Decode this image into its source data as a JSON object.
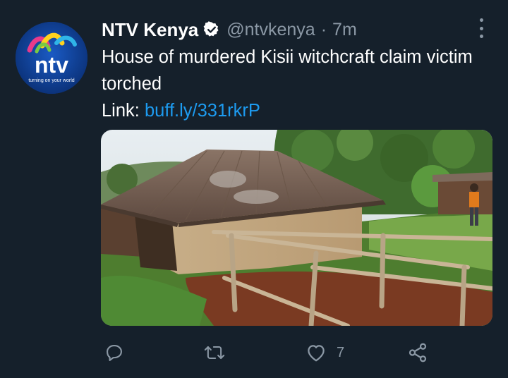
{
  "tweet": {
    "author_name": "NTV Kenya",
    "handle": "@ntvkenya",
    "separator": "·",
    "time": "7m",
    "text_line": "House of murdered Kisii witchcraft claim victim torched",
    "link_label": "Link: ",
    "link_text": "buff.ly/331rkrP",
    "avatar": {
      "logo_text": "ntv",
      "tagline": "turning on your world"
    },
    "actions": {
      "reply_icon": "reply-icon",
      "retweet_icon": "retweet-icon",
      "like_icon": "heart-icon",
      "like_count": "7",
      "share_icon": "share-icon"
    }
  },
  "colors": {
    "background": "#15202b",
    "link": "#1d9bf0",
    "secondary_text": "#8b98a5",
    "verified_badge": "#ffffff"
  }
}
